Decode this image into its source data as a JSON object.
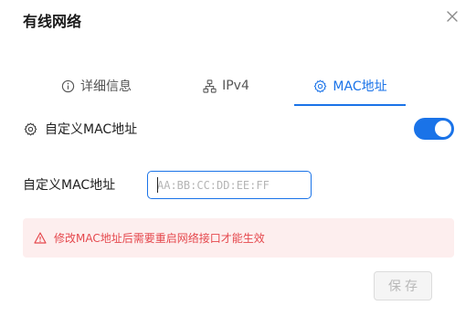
{
  "dialog": {
    "title": "有线网络",
    "close_icon": "close-icon"
  },
  "tabs": [
    {
      "label": "详细信息",
      "icon": "info-icon",
      "active": false
    },
    {
      "label": "IPv4",
      "icon": "network-icon",
      "active": false
    },
    {
      "label": "MAC地址",
      "icon": "gear-icon",
      "active": true
    }
  ],
  "custom_mac_toggle": {
    "label": "自定义MAC地址",
    "icon": "gear-icon",
    "enabled": true
  },
  "mac_field": {
    "label": "自定义MAC地址",
    "value": "",
    "placeholder": "AA:BB:CC:DD:EE:FF"
  },
  "warning": {
    "icon": "warning-icon",
    "text": "修改MAC地址后需要重启网络接口才能生效"
  },
  "footer": {
    "save_label": "保存",
    "save_enabled": false
  },
  "colors": {
    "accent": "#1a73e8",
    "warning_text": "#e5484d",
    "warning_bg": "#fdeeee",
    "disabled_text": "#b8b8b8"
  }
}
